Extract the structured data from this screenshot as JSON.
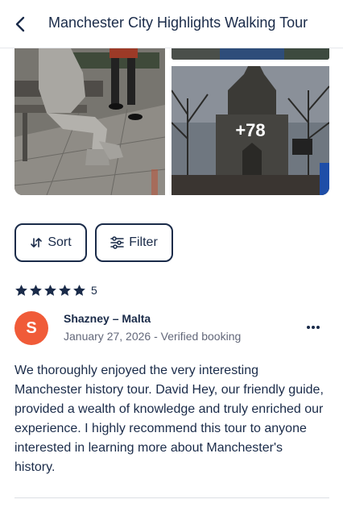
{
  "header": {
    "title": "Manchester City Highlights Walking Tour",
    "back_icon": "chevron-left-icon"
  },
  "gallery": {
    "more_label": "+78"
  },
  "controls": {
    "sort_label": "Sort",
    "sort_icon": "sort-arrows-icon",
    "filter_label": "Filter",
    "filter_icon": "sliders-icon"
  },
  "rating": {
    "stars": 5,
    "value": "5"
  },
  "review": {
    "avatar_initial": "S",
    "avatar_color": "#f05b38",
    "reviewer": "Shazney – Malta",
    "meta": "January 27, 2026 - Verified booking",
    "text": "We thoroughly enjoyed the very interesting Manchester history tour. David Hey, our friendly guide, provided a wealth of knowledge and truly enriched our experience. I highly recommend this tour to anyone interested in learning more about Manchester's history."
  },
  "colors": {
    "text": "#1a2b49",
    "muted": "#63687a",
    "accent": "#f05b38"
  }
}
